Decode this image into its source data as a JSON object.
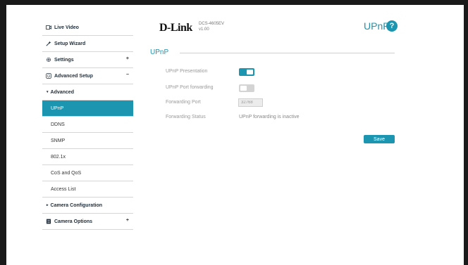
{
  "header": {
    "brand": "D-Link",
    "model": "DCS-4605EV",
    "version": "v1.00",
    "page_title": "UPnP",
    "help_symbol": "?"
  },
  "sidebar": {
    "items": [
      {
        "label": "Live Video",
        "icon": "video-icon",
        "expander": ""
      },
      {
        "label": "Setup Wizard",
        "icon": "wand-icon",
        "expander": ""
      },
      {
        "label": "Settings",
        "icon": "gear-icon",
        "expander": "+"
      },
      {
        "label": "Advanced Setup",
        "icon": "advanced-gear-icon",
        "expander": "−"
      },
      {
        "label": "Advanced",
        "arrow": "▾"
      },
      {
        "label": "UPnP",
        "active": true
      },
      {
        "label": "DDNS"
      },
      {
        "label": "SNMP"
      },
      {
        "label": "802.1x"
      },
      {
        "label": "CoS and QoS"
      },
      {
        "label": "Access List"
      },
      {
        "label": "Camera Configuration",
        "arrow": "▸"
      },
      {
        "label": "Camera Options",
        "icon": "document-icon",
        "expander": "+"
      }
    ]
  },
  "section": {
    "title": "UPnP",
    "upnp_presentation_label": "UPnP Presentation",
    "upnp_presentation_on": true,
    "upnp_port_forwarding_label": "UPnP Port forwarding",
    "upnp_port_forwarding_on": false,
    "forwarding_port_label": "Forwarding Port",
    "forwarding_port_value": "32768",
    "forwarding_status_label": "Forwarding Status",
    "forwarding_status_value": "UPnP forwarding is inactive",
    "save_label": "Save"
  },
  "colors": {
    "accent": "#1c95b0",
    "toggle_off": "#d4d4d4"
  }
}
